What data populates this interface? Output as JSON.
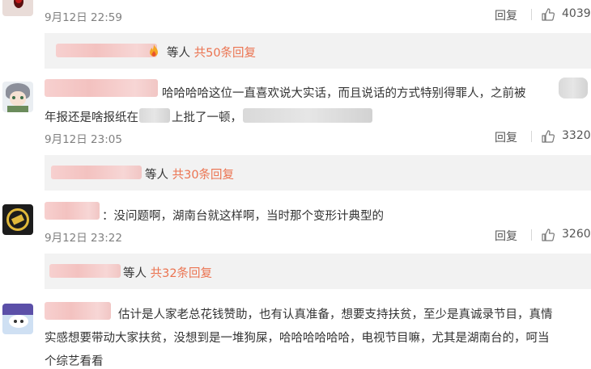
{
  "comments": [
    {
      "time": "9月12日 22:59",
      "reply_label": "回复",
      "likes": "4039",
      "replies": {
        "suffix": "等人",
        "count": "共50条回复"
      }
    },
    {
      "text_line1": "哈哈哈哈这位一直喜欢说大实话，而且说话的方式特别得罪人，之前被",
      "text_line2a": "年报还是啥报纸在",
      "text_line2b": "上批了一顿，",
      "time": "9月12日 23:05",
      "reply_label": "回复",
      "likes": "3320",
      "replies": {
        "suffix": "等人",
        "count": "共30条回复"
      }
    },
    {
      "text_line1": "：没问题啊，湖南台就这样啊，当时那个变形计典型的",
      "time": "9月12日 23:22",
      "reply_label": "回复",
      "likes": "3260",
      "replies": {
        "suffix": "等人",
        "count": "共32条回复"
      }
    },
    {
      "text_line1": "估计是人家老总花钱赞助，也有认真准备，想要支持扶贫，至少是真诚录节目，真情",
      "text_line2": "实感想要带动大家扶贫，没想到是一堆狗屎，哈哈哈哈哈哈，电视节目嘛，尤其是湖南台的，呵当",
      "text_line3": "个综艺看看"
    }
  ],
  "colors": {
    "reply_count": "#eb7350",
    "reply_bg": "#f2f2f2",
    "time": "#808080"
  },
  "icons": [
    "thumbs-up-icon",
    "fire-icon"
  ]
}
